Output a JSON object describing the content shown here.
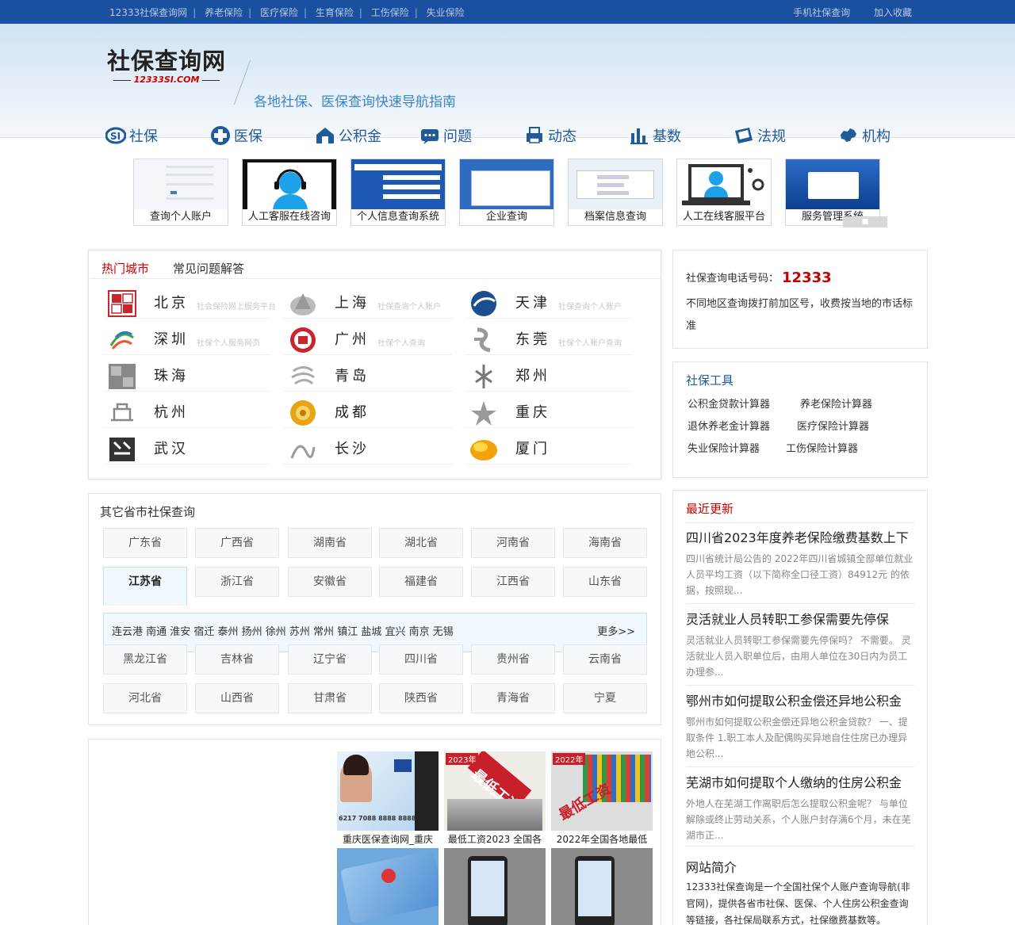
{
  "topbar": {
    "left": [
      "12333社保查询网",
      "养老保险",
      "医疗保险",
      "生育保险",
      "工伤保险",
      "失业保险"
    ],
    "right": [
      "手机社保查询",
      "加入收藏"
    ]
  },
  "header": {
    "logo_title": "社保查询网",
    "logo_sub": "12333SI.COM",
    "slogan": "各地社保、医保查询快速导航指南"
  },
  "nav": [
    "社保",
    "医保",
    "公积金",
    "问题",
    "动态",
    "基数",
    "法规",
    "机构"
  ],
  "services": [
    "查询个人账户",
    "人工客服在线咨询",
    "个人信息查询系统",
    "企业查询",
    "档案信息查询",
    "人工在线客服平台",
    "服务管理系统"
  ],
  "hot": {
    "tabs": [
      "热门城市",
      "常见问题解答"
    ],
    "cities": [
      {
        "name": "北京",
        "tag": "社会保险网上服务平台"
      },
      {
        "name": "上海",
        "tag": "社保查询个人账户"
      },
      {
        "name": "天津",
        "tag": "社保查询个人账户"
      },
      {
        "name": "深圳",
        "tag": "社保个人服务网页"
      },
      {
        "name": "广州",
        "tag": "社保个人查询"
      },
      {
        "name": "东莞",
        "tag": "社保个人账户查询"
      },
      {
        "name": "珠海",
        "tag": ""
      },
      {
        "name": "青岛",
        "tag": ""
      },
      {
        "name": "郑州",
        "tag": ""
      },
      {
        "name": "杭州",
        "tag": ""
      },
      {
        "name": "成都",
        "tag": ""
      },
      {
        "name": "重庆",
        "tag": ""
      },
      {
        "name": "武汉",
        "tag": ""
      },
      {
        "name": "长沙",
        "tag": ""
      },
      {
        "name": "厦门",
        "tag": ""
      }
    ]
  },
  "provinces": {
    "title": "其它省市社保查询",
    "row1": [
      "广东省",
      "广西省",
      "湖南省",
      "湖北省",
      "河南省",
      "海南省"
    ],
    "row2": [
      "江苏省",
      "浙江省",
      "安徽省",
      "福建省",
      "江西省",
      "山东省"
    ],
    "jiangsu_cities": "连云港 南通 淮安 宿迁 泰州 扬州 徐州 苏州 常州 镇江 盐城 宜兴 南京 无锡",
    "more": "更多>>",
    "row3": [
      "黑龙江省",
      "吉林省",
      "辽宁省",
      "四川省",
      "贵州省",
      "云南省"
    ],
    "row4": [
      "河北省",
      "山西省",
      "甘肃省",
      "陕西省",
      "青海省",
      "宁夏"
    ]
  },
  "phone": {
    "label": "社保查询电话号码：",
    "number": "12333",
    "desc": "不同地区查询拨打前加区号，收费按当地的市话标准"
  },
  "tools": {
    "title": "社保工具",
    "items": [
      "公积金贷款计算器",
      "养老保险计算器",
      "退休养老金计算器",
      "医疗保险计算器",
      "失业保险计算器",
      "工伤保险计算器"
    ]
  },
  "recent": {
    "title": "最近更新",
    "articles": [
      {
        "title": "四川省2023年度养老保险缴费基数上下",
        "desc": "四川省统计局公告的 2022年四川省城镇全部单位就业人员平均工资（以下简称全口径工资）84912元 的依据，按照现..."
      },
      {
        "title": "灵活就业人员转职工参保需要先停保",
        "desc": "灵活就业人员转职工参保需要先停保吗？ 不需要。 灵活就业人员入职单位后，由用人单位在30日内为员工办理参..."
      },
      {
        "title": "鄂州市如何提取公积金偿还异地公积金",
        "desc": "鄂州市如何提取公积金偿还异地公积金贷款？ 一、提取条件 1.职工本人及配偶购买异地自住住房已办理异地公积..."
      },
      {
        "title": "芜湖市如何提取个人缴纳的住房公积金",
        "desc": "外地人在芜湖工作离职后怎么提取公积金呢？ 与单位解除或终止劳动关系，个人账户封存满6个月，未在芜湖市正..."
      }
    ]
  },
  "intro": {
    "title": "网站简介",
    "body": "12333社保查询是一个全国社保个人账户查询导航(非官网)，提供各省市社保、医保、个人住房公积金查询等链接，各社保局联系方式，社保缴费基数等。"
  },
  "news": [
    {
      "caption": "重庆医保查询网_重庆",
      "badge": ""
    },
    {
      "caption": "最低工资2023 全国各",
      "badge": "2023年"
    },
    {
      "caption": "2022年全国各地最低",
      "badge": "2022年"
    }
  ],
  "news_art": {
    "card_number": "6217 7088 8888 8888",
    "stamp_text": "最低工资",
    "stamp_text2": "最低工资"
  },
  "colors": {
    "topbar": "#1b4fa0",
    "nav_text": "#1f5a99",
    "accent_red": "#c40000"
  }
}
